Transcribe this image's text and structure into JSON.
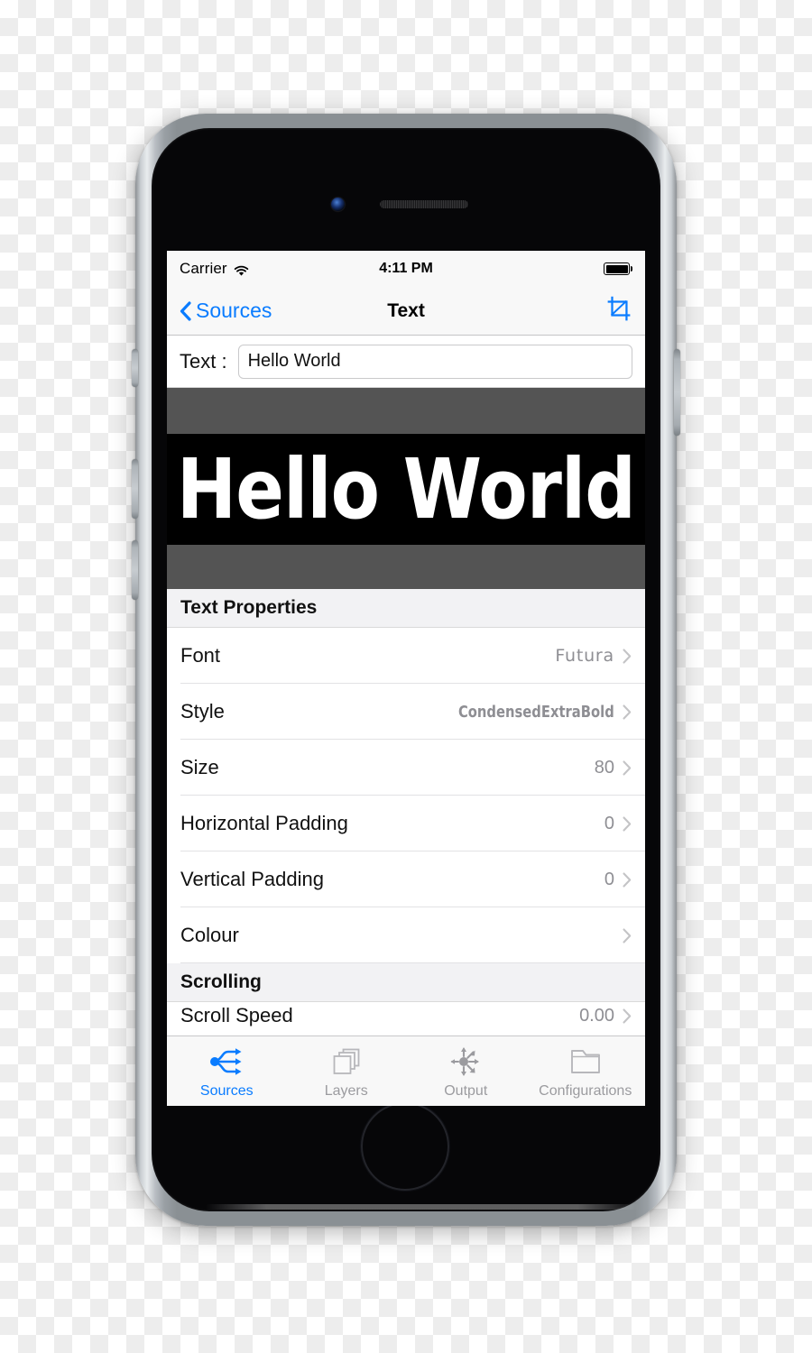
{
  "status_bar": {
    "carrier": "Carrier",
    "wifi_icon": "wifi-icon",
    "time": "4:11 PM",
    "battery_icon": "battery-full-icon"
  },
  "nav_bar": {
    "back_icon": "chevron-left-icon",
    "back_label": "Sources",
    "title": "Text",
    "right_icon": "crop-icon"
  },
  "text_field": {
    "label": "Text :",
    "value": "Hello World",
    "placeholder": "Hello World"
  },
  "preview": {
    "text": "Hello World",
    "band_color": "#545454",
    "canvas_color": "#000000",
    "text_color": "#ffffff"
  },
  "sections": [
    {
      "header": "Text Properties",
      "rows": [
        {
          "label": "Font",
          "value": "Futura",
          "value_style": "futura"
        },
        {
          "label": "Style",
          "value": "CondensedExtraBold",
          "value_style": "condensed"
        },
        {
          "label": "Size",
          "value": "80",
          "value_style": "plain"
        },
        {
          "label": "Horizontal Padding",
          "value": "0",
          "value_style": "plain"
        },
        {
          "label": "Vertical Padding",
          "value": "0",
          "value_style": "plain"
        },
        {
          "label": "Colour",
          "value": "",
          "value_style": "plain"
        }
      ]
    },
    {
      "header": "Scrolling",
      "rows": [
        {
          "label": "Scroll Speed",
          "value": "0.00",
          "value_style": "plain"
        }
      ]
    }
  ],
  "tab_bar": {
    "tabs": [
      {
        "label": "Sources",
        "icon": "branch-arrows-icon",
        "active": true
      },
      {
        "label": "Layers",
        "icon": "stacked-squares-icon",
        "active": false
      },
      {
        "label": "Output",
        "icon": "radiating-arrows-icon",
        "active": false
      },
      {
        "label": "Configurations",
        "icon": "folder-icon",
        "active": false
      }
    ]
  },
  "colors": {
    "accent": "#0a7cff",
    "inactive": "#9b9b9f",
    "value_gray": "#8e8e93",
    "section_bg": "#f2f2f4"
  }
}
